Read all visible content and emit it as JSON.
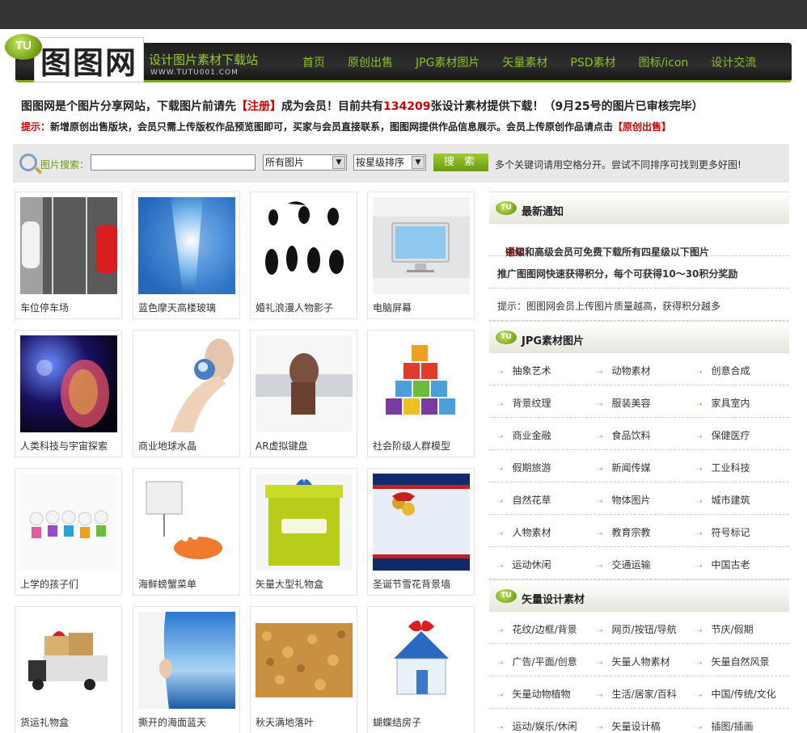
{
  "header": {
    "badge": "TU",
    "logo": "图图网",
    "slogan": "设计图片素材下载站",
    "domain": "WWW.TUTU001.COM",
    "nav": [
      "首页",
      "原创出售",
      "JPG素材图片",
      "矢量素材",
      "PSD素材",
      "图标/icon",
      "设计交流"
    ]
  },
  "intro": {
    "p1": "图图网是个图片分享网站，下载图片前请先",
    "register": "【注册】",
    "p2": "成为会员！目前共有",
    "count": "134209",
    "p3": "张设计素材提供下载！（9月25号的图片已审核完毕）"
  },
  "tip": {
    "label": "提示：",
    "text": "新增原创出售版块，会员只需上传版权作品预览图即可，买家与会员直接联系，图图网提供作品信息展示。会员上传原创作品请点击",
    "link": "【原创出售】"
  },
  "search": {
    "label": "图片搜索：",
    "value": "",
    "scope": "所有图片",
    "sort": "按星级排序",
    "button": "搜 索",
    "hint": "多个关键词请用空格分开。尝试不同排序可找到更多好图!"
  },
  "images": [
    "车位停车场",
    "蓝色摩天高楼玻璃",
    "婚礼浪漫人物影子",
    "电脑屏幕",
    "人类科技与宇宙探索",
    "商业地球水晶",
    "AR虚拟键盘",
    "社会阶级人群模型",
    "上学的孩子们",
    "海鲜螃蟹菜单",
    "矢量大型礼物盒",
    "圣诞节雪花背景墙",
    "货运礼物盒",
    "撕开的海面蓝天",
    "秋天满地落叶",
    "蝴蝶结房子"
  ],
  "sidebar": {
    "badge": "TU",
    "notice_title": "最新通知",
    "notices": [
      {
        "label": "通知：",
        "text": "中级和高级会员可免费下载所有四星级以下图片"
      },
      {
        "label": "",
        "text": "推广图图网快速获得积分，每个可获得10～30积分奖励"
      },
      {
        "label": "",
        "text": "提示：图图网会员上传图片质量越高，获得积分越多"
      }
    ],
    "jpg_title": "JPG素材图片",
    "jpg_cats": [
      [
        "抽象艺术",
        "动物素材",
        "创意合成"
      ],
      [
        "背景纹理",
        "服装美容",
        "家具室内"
      ],
      [
        "商业金融",
        "食品饮料",
        "保健医疗"
      ],
      [
        "假期旅游",
        "新闻传媒",
        "工业科技"
      ],
      [
        "自然花草",
        "物体图片",
        "城市建筑"
      ],
      [
        "人物素材",
        "教育宗教",
        "符号标记"
      ],
      [
        "运动休闲",
        "交通运输",
        "中国古老"
      ]
    ],
    "vec_title": "矢量设计素材",
    "vec_cats": [
      [
        "花纹/边框/背景",
        "网页/按钮/导航",
        "节庆/假期"
      ],
      [
        "广告/平面/创意",
        "矢量人物素材",
        "矢量自然风景"
      ],
      [
        "矢量动物植物",
        "生活/居家/百科",
        "中国/传统/文化"
      ],
      [
        "运动/娱乐/休闲",
        "矢量设计稿",
        "插图/插画"
      ]
    ]
  }
}
